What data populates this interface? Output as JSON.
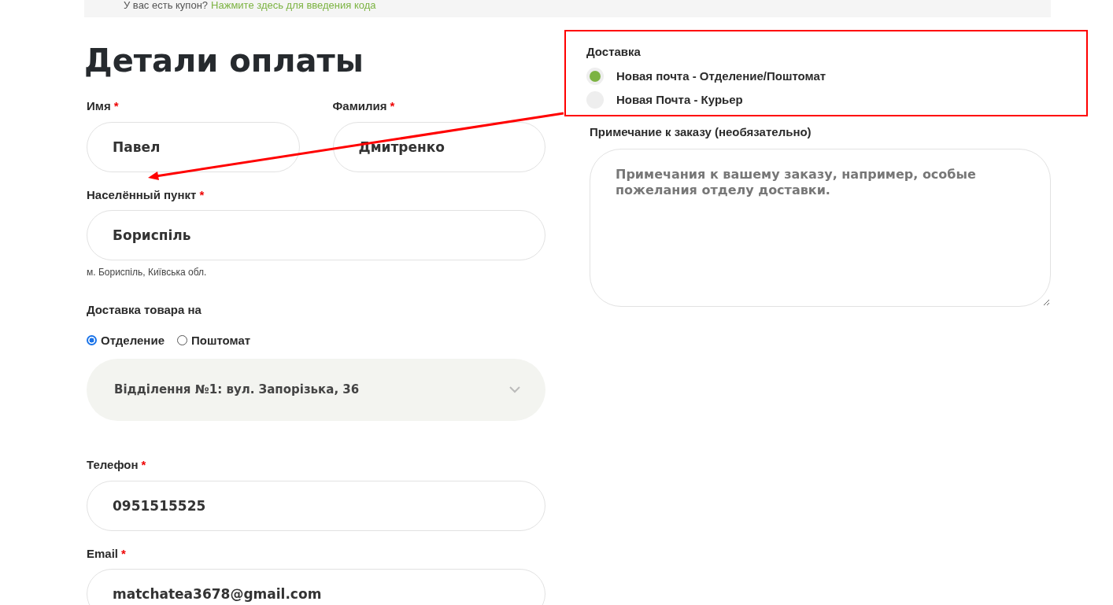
{
  "coupon_notice": {
    "text": "У вас есть купон?",
    "link": "Нажмите здесь для введения кода"
  },
  "heading": "Детали оплаты",
  "name_fields": [
    {
      "label": "Имя",
      "required_mark": "*",
      "value": "Павел"
    },
    {
      "label": "Фамилия",
      "required_mark": "*",
      "value": "Дмитренко"
    }
  ],
  "city": {
    "label": "Населённый пункт",
    "required_mark": "*",
    "value": "Бориспіль",
    "hint": "м. Бориспіль, Київська обл."
  },
  "delivery_to": {
    "label": "Доставка товара на",
    "options": [
      {
        "label": "Отделение",
        "selected": true
      },
      {
        "label": "Поштомат",
        "selected": false
      }
    ],
    "branch": "Відділення №1: вул. Запорізька, 36"
  },
  "contact_fields": [
    {
      "label": "Телефон",
      "required_mark": "*",
      "value": "0951515525"
    },
    {
      "label": "Email",
      "required_mark": "*",
      "value": "matchatea3678@gmail.com"
    }
  ],
  "shipping": {
    "title": "Доставка",
    "options": [
      {
        "label": "Новая почта - Отделение/Поштомат",
        "selected": true
      },
      {
        "label": "Новая Почта - Курьер",
        "selected": false
      }
    ]
  },
  "order_note": {
    "label": "Примечание к заказу (необязательно)",
    "placeholder": "Примечания к вашему заказу, например, особые пожелания отделу доставки."
  }
}
